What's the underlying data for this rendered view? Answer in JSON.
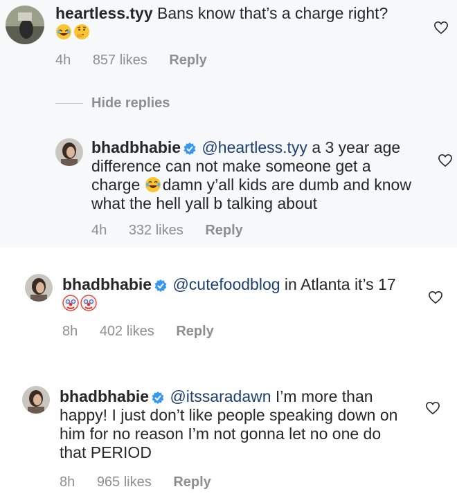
{
  "comments": [
    {
      "username": "heartless.tyy",
      "text": "Bans know that’s a charge right?",
      "emojis": [
        "rolling-laughing-emoji",
        "thinking-face-emoji"
      ],
      "time": "4h",
      "likes": "857 likes",
      "reply": "Reply"
    },
    {
      "username": "bhadbhabie",
      "verified": true,
      "mention": "@heartless.tyy",
      "text_before_emoji": "a 3 year age difference can not make someone get a charge",
      "emoji": "tears-of-joy-emoji",
      "text_after_emoji": "damn y’all kids are dumb and know what the hell yall b talking about",
      "time": "4h",
      "likes": "332 likes",
      "reply": "Reply"
    },
    {
      "username": "bhadbhabie",
      "verified": true,
      "mention": "@cutefoodblog",
      "text": "in Atlanta it’s 17",
      "emojis": [
        "clown-face-emoji",
        "clown-face-emoji"
      ],
      "time": "8h",
      "likes": "402 likes",
      "reply": "Reply"
    },
    {
      "username": "bhadbhabie",
      "verified": true,
      "mention": "@itssaradawn",
      "text": "I’m more than happy! I just don’t like people speaking down on him for no reason I’m not gonna let no one do that PERIOD",
      "time": "8h",
      "likes": "965 likes",
      "reply": "Reply"
    }
  ],
  "hide_replies": "Hide replies",
  "colors": {
    "mention": "#1b3f70",
    "verified": "#3897f0",
    "meta": "#8e8e8e",
    "section_bg": "#f7f8fa"
  },
  "icons": [
    "heart-outline-icon",
    "verified-badge-icon"
  ]
}
